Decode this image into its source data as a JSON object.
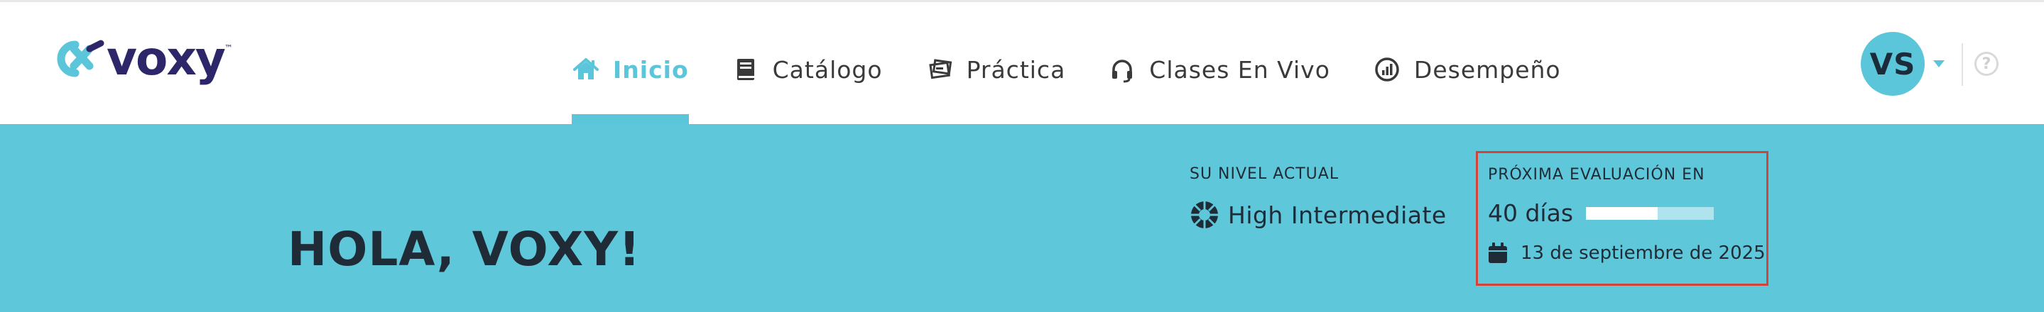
{
  "brand": {
    "name": "voxy",
    "tm": "™",
    "colors": {
      "navy": "#2d2668",
      "teal": "#5bc5d9"
    }
  },
  "nav": {
    "items": [
      {
        "label": "Inicio",
        "icon": "home-icon",
        "active": true
      },
      {
        "label": "Catálogo",
        "icon": "book-icon",
        "active": false
      },
      {
        "label": "Práctica",
        "icon": "practice-icon",
        "active": false
      },
      {
        "label": "Clases En Vivo",
        "icon": "headset-icon",
        "active": false
      },
      {
        "label": "Desempeño",
        "icon": "performance-icon",
        "active": false
      }
    ]
  },
  "user": {
    "initials": "VS",
    "help": "?"
  },
  "hero": {
    "greeting": "HOLA, VOXY!",
    "level": {
      "label": "SU NIVEL ACTUAL",
      "value": "High Intermediate"
    },
    "evaluation": {
      "label": "PRÓXIMA EVALUACIÓN EN",
      "days": "40 días",
      "progress": 0.56,
      "date": "13 de septiembre de 2025"
    }
  },
  "colors": {
    "hero_bg": "#5fc7da",
    "highlight_border": "#d0443a"
  }
}
